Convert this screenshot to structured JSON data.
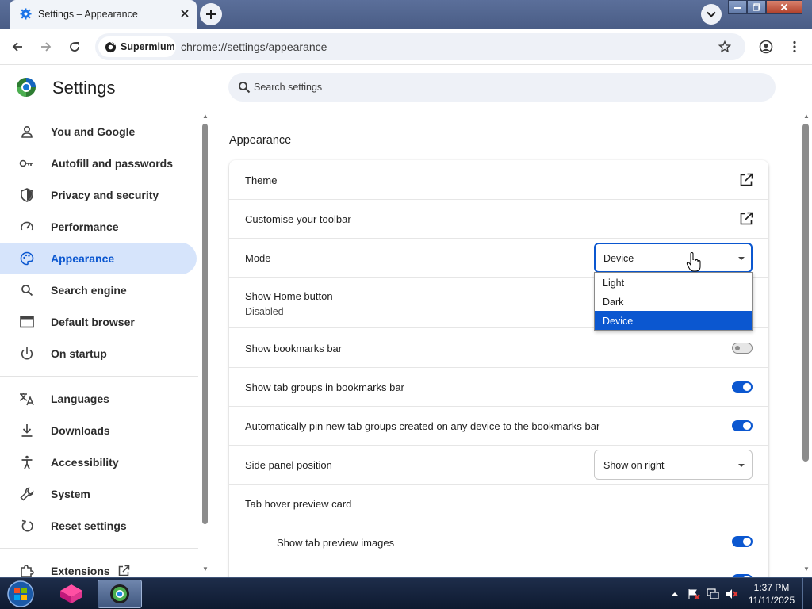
{
  "browser": {
    "tab_title": "Settings – Appearance",
    "site_chip_label": "Supermium",
    "url": "chrome://settings/appearance"
  },
  "settings": {
    "title": "Settings",
    "search_placeholder": "Search settings"
  },
  "sidebar": {
    "items": [
      {
        "label": "You and Google",
        "icon": "person-icon"
      },
      {
        "label": "Autofill and passwords",
        "icon": "key-icon"
      },
      {
        "label": "Privacy and security",
        "icon": "shield-icon"
      },
      {
        "label": "Performance",
        "icon": "speedometer-icon"
      },
      {
        "label": "Appearance",
        "icon": "palette-icon",
        "active": true
      },
      {
        "label": "Search engine",
        "icon": "search-icon"
      },
      {
        "label": "Default browser",
        "icon": "browser-window-icon"
      },
      {
        "label": "On startup",
        "icon": "power-icon"
      },
      {
        "label": "Languages",
        "icon": "translate-icon"
      },
      {
        "label": "Downloads",
        "icon": "download-icon"
      },
      {
        "label": "Accessibility",
        "icon": "accessibility-icon"
      },
      {
        "label": "System",
        "icon": "wrench-icon"
      },
      {
        "label": "Reset settings",
        "icon": "reset-icon"
      },
      {
        "label": "Extensions",
        "icon": "puzzle-icon"
      }
    ]
  },
  "appearance": {
    "section_title": "Appearance",
    "rows": {
      "theme": "Theme",
      "customise_toolbar": "Customise your toolbar",
      "mode": "Mode",
      "show_home_button": "Show Home button",
      "show_home_button_status": "Disabled",
      "show_bookmarks_bar": "Show bookmarks bar",
      "show_tab_groups": "Show tab groups in bookmarks bar",
      "auto_pin": "Automatically pin new tab groups created on any device to the bookmarks bar",
      "side_panel_position": "Side panel position",
      "tab_hover_preview": "Tab hover preview card",
      "show_tab_preview_images": "Show tab preview images"
    },
    "mode_value": "Device",
    "mode_options": [
      "Light",
      "Dark",
      "Device"
    ],
    "mode_selected": "Device",
    "side_panel_value": "Show on right",
    "toggles": {
      "show_bookmarks_bar": false,
      "show_tab_groups": true,
      "auto_pin": true,
      "show_tab_preview_images": true
    }
  },
  "taskbar": {
    "time": "1:37 PM",
    "date": "11/11/2025"
  },
  "colors": {
    "accent": "#0b57d0",
    "active_nav_bg": "#d6e4fb",
    "titlebar": "#4a5d86"
  }
}
